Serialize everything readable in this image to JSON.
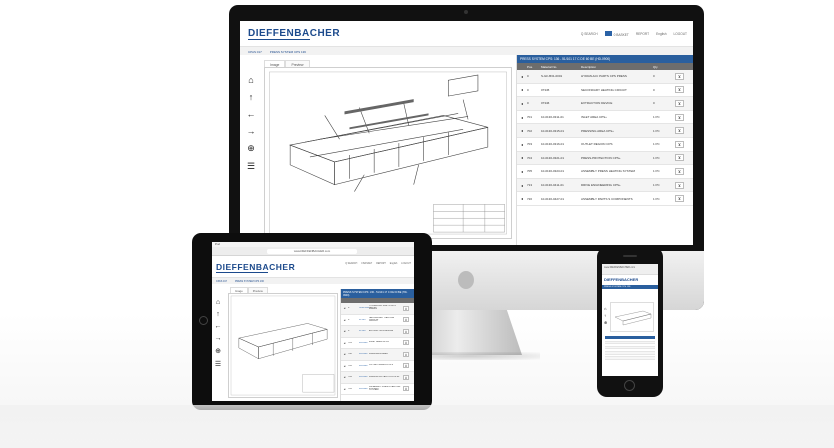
{
  "brand": {
    "name": "DIEFFENBACHER",
    "accent": "#1c4a8c",
    "panel_blue": "#2a5f9e"
  },
  "header": {
    "links": [
      "Q SEARCH",
      "0 BASKET",
      "REPORT",
      "English",
      "LOGOUT"
    ]
  },
  "breadcrumb": [
    "CPAS 017",
    "PRESS SYSTEM CPS 136"
  ],
  "tabs": [
    "Image",
    "Preview"
  ],
  "toolbar_icons": [
    "home-icon",
    "arrow-up-icon",
    "arrow-left-icon",
    "arrow-right-icon",
    "zoom-icon",
    "tree-icon"
  ],
  "desktop_panel": {
    "title": "PRESS SYSTEM CPS: 136 - 51/101 17 C DE 60 BE (HD-0900)",
    "columns": [
      "",
      "Pos.",
      "Material No.",
      "Description",
      "Qty",
      ""
    ],
    "rows": [
      {
        "pos": "0",
        "material": "S-GF-B31-0001",
        "description": "HYDRAULIC PARTS CPS PRESS",
        "qty": "0"
      },
      {
        "pos": "0",
        "material": "07345",
        "description": "SECONDARY HEATING CIRCUIT",
        "qty": "0"
      },
      {
        "pos": "0",
        "material": "07346",
        "description": "EXTRACTION DEVICE",
        "qty": "0"
      },
      {
        "pos": "701",
        "material": "10-0130-0311-01",
        "description": "INLET AREA CPS+",
        "qty": "1 PC"
      },
      {
        "pos": "702",
        "material": "10-0130-0315-01",
        "description": "PRESSING AREA CPS+",
        "qty": "1 PC"
      },
      {
        "pos": "703",
        "material": "10-0130-0316-01",
        "description": "OUTLET REGION CPS",
        "qty": "1 PC"
      },
      {
        "pos": "704",
        "material": "10-0130-0321-01",
        "description": "PRESS-PROTECTION CPS+",
        "qty": "1 PC"
      },
      {
        "pos": "705",
        "material": "10-0130-0323-01",
        "description": "ASSEMBLY PRESS HEATING SYSTEM",
        "qty": "1 PC"
      },
      {
        "pos": "713",
        "material": "10-0130-0411-01",
        "description": "DRIVE ENGINEERING CPS+",
        "qty": "1 PC"
      },
      {
        "pos": "720",
        "material": "10-0130-0427-01",
        "description": "ASSEMBLY PARTS S COMPONENTS",
        "qty": "1 PC"
      }
    ]
  },
  "tablet": {
    "status_left": "iPad",
    "url": "www.DIEFFENBACHER.com",
    "panel_title": "PRESS SYSTEM CPS: 136 - 51/101 17 C DE 60 BE (HD-0900)",
    "rows": [
      {
        "pos": "0",
        "material": "S-GF-B31",
        "description": "HYDRAULIC PARTS CPS PRESS"
      },
      {
        "pos": "0",
        "material": "07345",
        "description": "SECONDARY HEATING CIRCUIT"
      },
      {
        "pos": "0",
        "material": "07346",
        "description": "EXTRACTION DEVICE"
      },
      {
        "pos": "701",
        "material": "10-0130",
        "description": "INLET AREA CPS+"
      },
      {
        "pos": "702",
        "material": "10-0130",
        "description": "PRESSING AREA"
      },
      {
        "pos": "703",
        "material": "10-0130",
        "description": "OUTLET REGION CPS"
      },
      {
        "pos": "704",
        "material": "10-0130",
        "description": "PRESS-PROTECTION CPS+"
      },
      {
        "pos": "705",
        "material": "10-0130",
        "description": "ASSEMBLY PRESS HEATING SYSTEM"
      }
    ]
  },
  "phone": {
    "url": "www.DIEFFENBACHER.com"
  }
}
